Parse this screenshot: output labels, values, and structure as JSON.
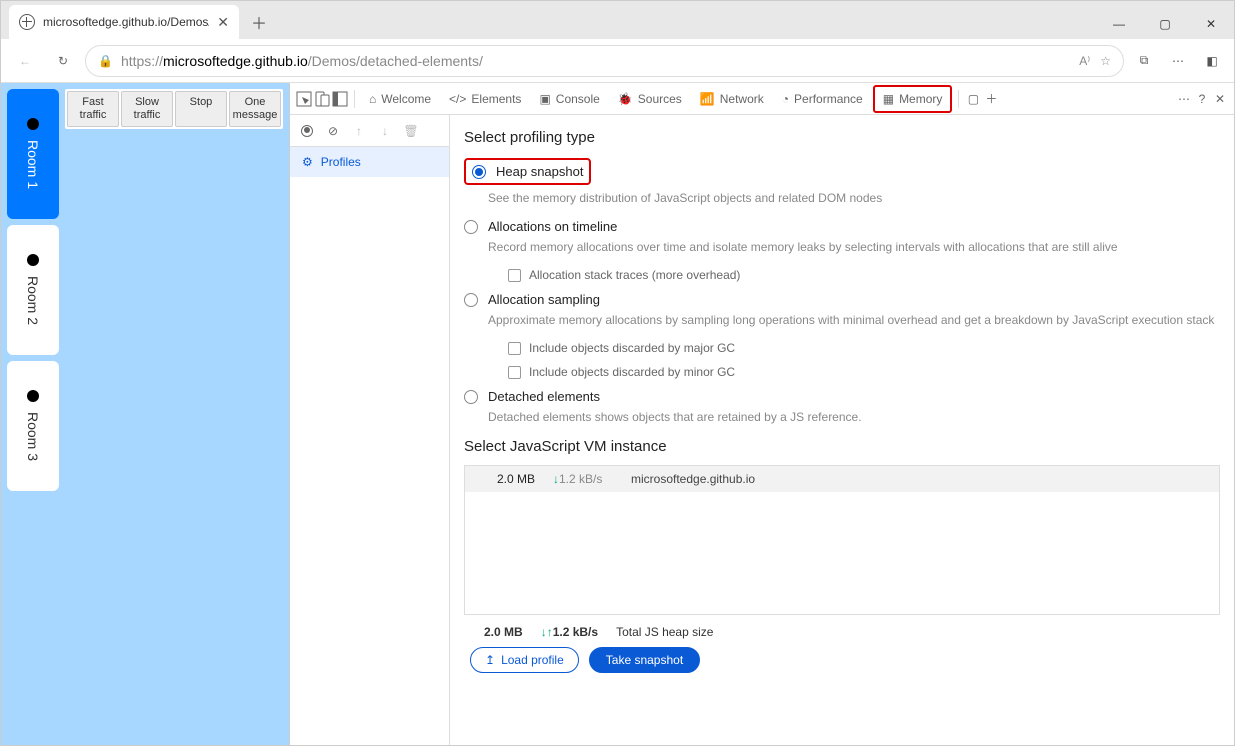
{
  "browser": {
    "tab_title": "microsoftedge.github.io/Demos/d",
    "url_scheme": "https://",
    "url_host": "microsoftedge.github.io",
    "url_path": "/Demos/detached-elements/"
  },
  "window_controls": {
    "min": "—",
    "max": "▢",
    "close": "✕"
  },
  "page": {
    "rooms": [
      {
        "label": "Room 1",
        "active": true
      },
      {
        "label": "Room 2",
        "active": false
      },
      {
        "label": "Room 3",
        "active": false
      }
    ],
    "traffic_buttons": [
      "Fast traffic",
      "Slow traffic",
      "Stop",
      "One message"
    ]
  },
  "devtools": {
    "tabs": [
      "Welcome",
      "Elements",
      "Console",
      "Sources",
      "Network",
      "Performance",
      "Memory"
    ],
    "active_tab": "Memory",
    "left_panel_item": "Profiles",
    "section1_title": "Select profiling type",
    "options": [
      {
        "label": "Heap snapshot",
        "desc": "See the memory distribution of JavaScript objects and related DOM nodes",
        "selected": true,
        "highlighted": true
      },
      {
        "label": "Allocations on timeline",
        "desc": "Record memory allocations over time and isolate memory leaks by selecting intervals with allocations that are still alive",
        "selected": false,
        "checks": [
          "Allocation stack traces (more overhead)"
        ]
      },
      {
        "label": "Allocation sampling",
        "desc": "Approximate memory allocations by sampling long operations with minimal overhead and get a breakdown by JavaScript execution stack",
        "selected": false,
        "checks": [
          "Include objects discarded by major GC",
          "Include objects discarded by minor GC"
        ]
      },
      {
        "label": "Detached elements",
        "desc": "Detached elements shows objects that are retained by a JS reference.",
        "selected": false
      }
    ],
    "section2_title": "Select JavaScript VM instance",
    "vm_row": {
      "size": "2.0 MB",
      "rate_arrow": "↓",
      "rate": "1.2 kB/s",
      "name": "microsoftedge.github.io"
    },
    "footer": {
      "size": "2.0 MB",
      "rate_arrow": "↓↑",
      "rate": "1.2 kB/s",
      "label": "Total JS heap size"
    },
    "btn_load": "Load profile",
    "btn_take": "Take snapshot"
  }
}
